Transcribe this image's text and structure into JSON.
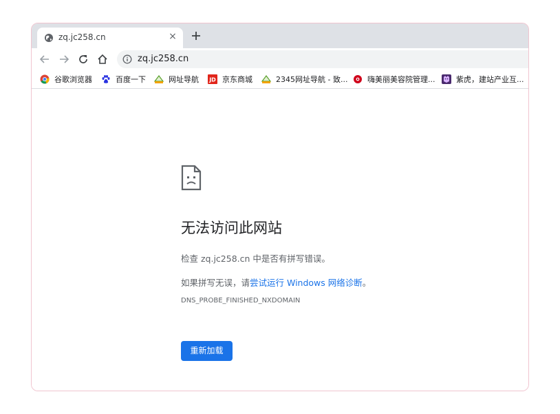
{
  "tab": {
    "title": "zq.jc258.cn",
    "close_glyph": "×",
    "favicon": "globe-icon"
  },
  "toolbar": {
    "back_icon": "back-arrow-icon",
    "forward_icon": "forward-arrow-icon",
    "reload_icon": "reload-icon",
    "home_icon": "home-icon",
    "url": "zq.jc258.cn"
  },
  "bookmarks": [
    {
      "label": "谷歌浏览器",
      "icon": "chrome-icon"
    },
    {
      "label": "百度一下",
      "icon": "baidu-paw-icon"
    },
    {
      "label": "网址导航",
      "icon": "2345-icon"
    },
    {
      "label": "京东商城",
      "icon": "jd-icon"
    },
    {
      "label": "2345网址导航 - 致...",
      "icon": "2345-icon"
    },
    {
      "label": "嗨美丽美容院管理...",
      "icon": "flower-icon"
    },
    {
      "label": "紫虎，建站产业互...",
      "icon": "tiger-icon"
    }
  ],
  "error": {
    "title": "无法访问此网站",
    "line1_prefix": "检查 ",
    "line1_host": "zq.jc258.cn",
    "line1_suffix": " 中是否有拼写错误。",
    "line2_prefix": "如果拼写无误，请",
    "line2_link": "尝试运行 Windows 网络诊断",
    "line2_suffix": "。",
    "code": "DNS_PROBE_FINISHED_NXDOMAIN",
    "reload_label": "重新加载"
  },
  "colors": {
    "accent": "#1a73e8",
    "tabstrip": "#dee1e6",
    "omnibox": "#f1f3f4",
    "window_border": "#f0c4cf"
  }
}
